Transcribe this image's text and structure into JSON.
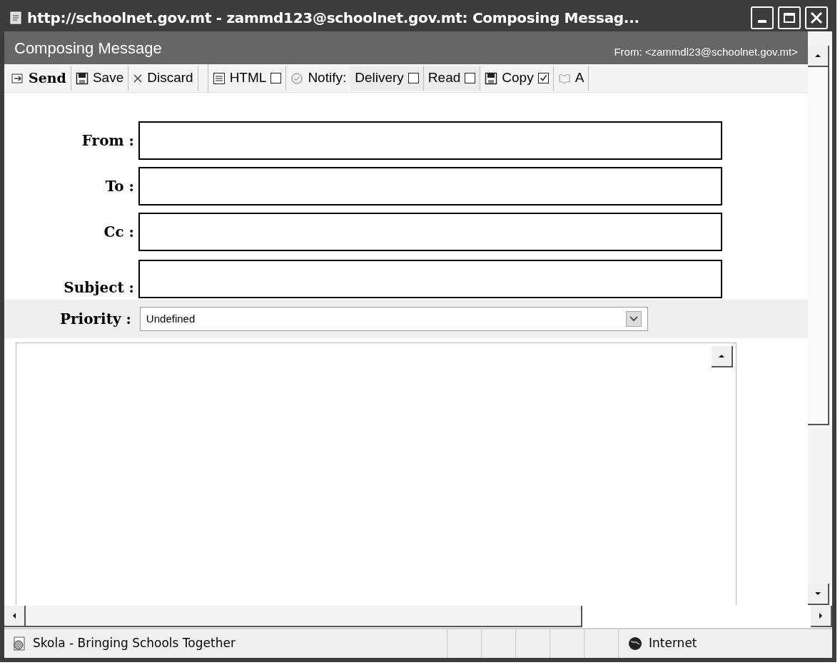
{
  "window": {
    "title": "http://schoolnet.gov.mt - zammd123@schoolnet.gov.mt: Composing Messag..."
  },
  "header": {
    "title": "Composing Message",
    "from": "From: <zammdl23@schoolnet.gov.mt>"
  },
  "toolbar": [
    {
      "kind": "button",
      "label": "Send"
    },
    {
      "kind": "button",
      "label": "Save"
    },
    {
      "kind": "button",
      "label": "Discard"
    },
    {
      "kind": "separator"
    },
    {
      "kind": "toggle",
      "label": "HTML",
      "checked": false
    },
    {
      "kind": "label",
      "label": "Notify:"
    },
    {
      "kind": "toggle",
      "label": "Delivery",
      "checked": false
    },
    {
      "kind": "toggle",
      "label": "Read",
      "checked": false
    },
    {
      "kind": "toggle",
      "label": "Copy",
      "checked": true
    },
    {
      "kind": "button",
      "label": "A"
    }
  ],
  "fields": [
    {
      "label": "From :"
    },
    {
      "label": "To :"
    },
    {
      "label": "Cc :"
    },
    {
      "label": "Subject :"
    }
  ],
  "priority": {
    "label": "Priority :",
    "value": "Undefined"
  },
  "status_bar": {
    "text": "Skola - Bringing Schools Together",
    "zone": "Internet"
  }
}
